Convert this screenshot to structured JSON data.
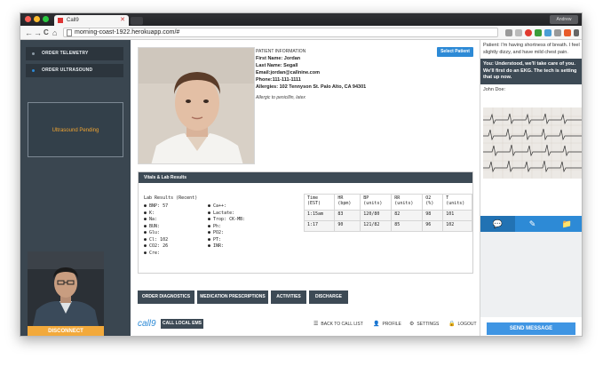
{
  "browser": {
    "tab_title": "Call9",
    "tab_close": "✕",
    "profile_label": "Andrew",
    "url": "morning-coast-1922.herokuapp.com/#",
    "back": "←",
    "forward": "→",
    "reload": "C",
    "home": "⌂"
  },
  "sidebar": {
    "items": [
      {
        "label": "ORDER TELEMETRY",
        "color": "#8c9aa6"
      },
      {
        "label": "ORDER ULTRASOUND",
        "color": "#2d8ad6"
      }
    ],
    "status": "Ultrasound Pending",
    "disconnect_label": "DISCONNECT"
  },
  "patient": {
    "header": "PATIENT INFORMATION",
    "first_name": "First Name: Jordan",
    "last_name": "Last Name: Segall",
    "email": "Email:jordan@callnine.com",
    "phone": "Phone:111-111-1111",
    "address": "Allergies: 102 Tennyson St. Palo Alto, CA 94301",
    "allergy_note": "Allergic to penicillin, latex",
    "select_button": "Select Patient"
  },
  "vitals": {
    "header": "Vitals & Lab Results",
    "lab_title": "Lab Results (Recent)",
    "labs_left": [
      "BNP: 57",
      "K:",
      "Na:",
      "BUN:",
      "Glu:",
      "Cl: 102",
      "CO2: 26",
      "Cre:"
    ],
    "labs_right": [
      "Ca++:",
      "Lactate:",
      "Trop: CK-MB:",
      "Ph:",
      "PO2:",
      "PT:",
      "INR:"
    ],
    "table": {
      "headers": [
        "Time (EST)",
        "HR (bpm)",
        "BP (units)",
        "RR (units)",
        "O2 (%)",
        "T (units)"
      ],
      "rows": [
        [
          "1:15am",
          "83",
          "120/80",
          "82",
          "98",
          "101"
        ],
        [
          "1:17",
          "90",
          "121/82",
          "85",
          "96",
          "102"
        ]
      ]
    }
  },
  "actions": {
    "order_diagnostics": "ORDER DIAGNOSTICS",
    "medication": "MEDICATION PRESCRIPTIONS",
    "activities": "ACTIVITIES",
    "discharge": "DISCHARGE"
  },
  "footer": {
    "logo": "call9",
    "call_ems": "CALL LOCAL EMS",
    "back_to_list": "BACK TO CALL LIST",
    "profile": "PROFILE",
    "settings": "SETTINGS",
    "logout": "LOGOUT"
  },
  "chat": {
    "patient_msg": "Patient: I'm having shortness of breath. I feel slightly dizzy, and have mild chest pain.",
    "you_msg": "You: Understood, we'll take care of you. We'll first do an EKG. The tech is setting that up now.",
    "john_label": "John Doe:",
    "send_label": "SEND MESSAGE",
    "tools": [
      "chat-icon",
      "edit-icon",
      "add-folder-icon"
    ]
  },
  "colors": {
    "accent": "#2d8ad6",
    "sidebar": "#3a4650",
    "pending": "#f0a431",
    "disconnect": "#f2a93b"
  }
}
